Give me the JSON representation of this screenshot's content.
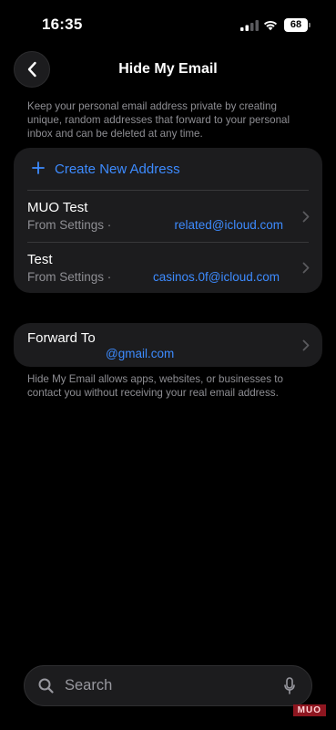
{
  "status_bar": {
    "time": "16:35",
    "battery": "68"
  },
  "nav": {
    "title": "Hide My Email"
  },
  "description": "Keep your personal email address private by creating unique, random addresses that forward to your personal inbox and can be deleted at any time.",
  "create": {
    "label": "Create New Address"
  },
  "addresses": [
    {
      "name": "MUO Test",
      "source": "From Settings ·",
      "email": "related@icloud.com"
    },
    {
      "name": "Test",
      "source": "From Settings ·",
      "email": "casinos.0f@icloud.com"
    }
  ],
  "forward": {
    "label": "Forward To",
    "value": "@gmail.com"
  },
  "footer_note": "Hide My Email allows apps, websites, or businesses to contact you without receiving your real email address.",
  "search": {
    "placeholder": "Search"
  },
  "watermark": "MUO",
  "colors": {
    "accent": "#3d8bff",
    "background": "#000000",
    "card": "#1c1c1e",
    "secondary_text": "#8e8e93"
  },
  "icons": [
    "back-chevron-icon",
    "signal-icon",
    "wifi-icon",
    "battery-icon",
    "plus-icon",
    "chevron-right-icon",
    "search-icon",
    "mic-icon"
  ]
}
